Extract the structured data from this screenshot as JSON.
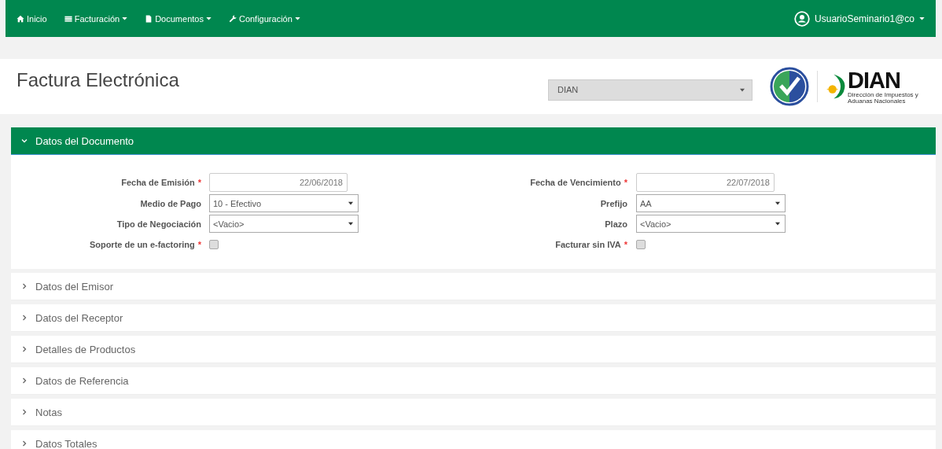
{
  "navbar": {
    "items": [
      {
        "label": "Inicio",
        "dropdown": false
      },
      {
        "label": "Facturación",
        "dropdown": true
      },
      {
        "label": "Documentos",
        "dropdown": true
      },
      {
        "label": "Configuración",
        "dropdown": true
      }
    ],
    "user": {
      "label": "UsuarioSeminario1@co",
      "dropdown": true
    }
  },
  "header": {
    "title": "Factura Electrónica",
    "provider_select": {
      "value": "DIAN"
    },
    "logo": {
      "name": "DIAN",
      "tagline": "Dirección de Impuestos y Aduanas Nacionales"
    }
  },
  "sections": [
    {
      "title": "Datos del Documento",
      "expanded": true,
      "columns": [
        [
          {
            "kind": "date",
            "label": "Fecha de Emisión",
            "required_mark": "*",
            "value": "22/06/2018"
          },
          {
            "kind": "select",
            "label": "Medio de Pago",
            "value": "10 - Efectivo"
          },
          {
            "kind": "select",
            "label": "Tipo de Negociación",
            "value": "<Vacio>"
          },
          {
            "kind": "checkbox",
            "label": "Soporte de un e-factoring",
            "required_mark": "*",
            "checked": false
          }
        ],
        [
          {
            "kind": "date",
            "label": "Fecha de Vencimiento",
            "required_mark": "*",
            "value": "22/07/2018"
          },
          {
            "kind": "select",
            "label": "Prefijo",
            "value": "AA"
          },
          {
            "kind": "select",
            "label": "Plazo",
            "value": "<Vacio>"
          },
          {
            "kind": "checkbox",
            "label": "Facturar sin IVA",
            "required_mark": "*",
            "checked": false
          }
        ]
      ]
    },
    {
      "title": "Datos del Emisor",
      "expanded": false
    },
    {
      "title": "Datos del Receptor",
      "expanded": false
    },
    {
      "title": "Detalles de Productos",
      "expanded": false
    },
    {
      "title": "Datos de Referencia",
      "expanded": false
    },
    {
      "title": "Notas",
      "expanded": false
    },
    {
      "title": "Datos Totales",
      "expanded": false
    }
  ]
}
